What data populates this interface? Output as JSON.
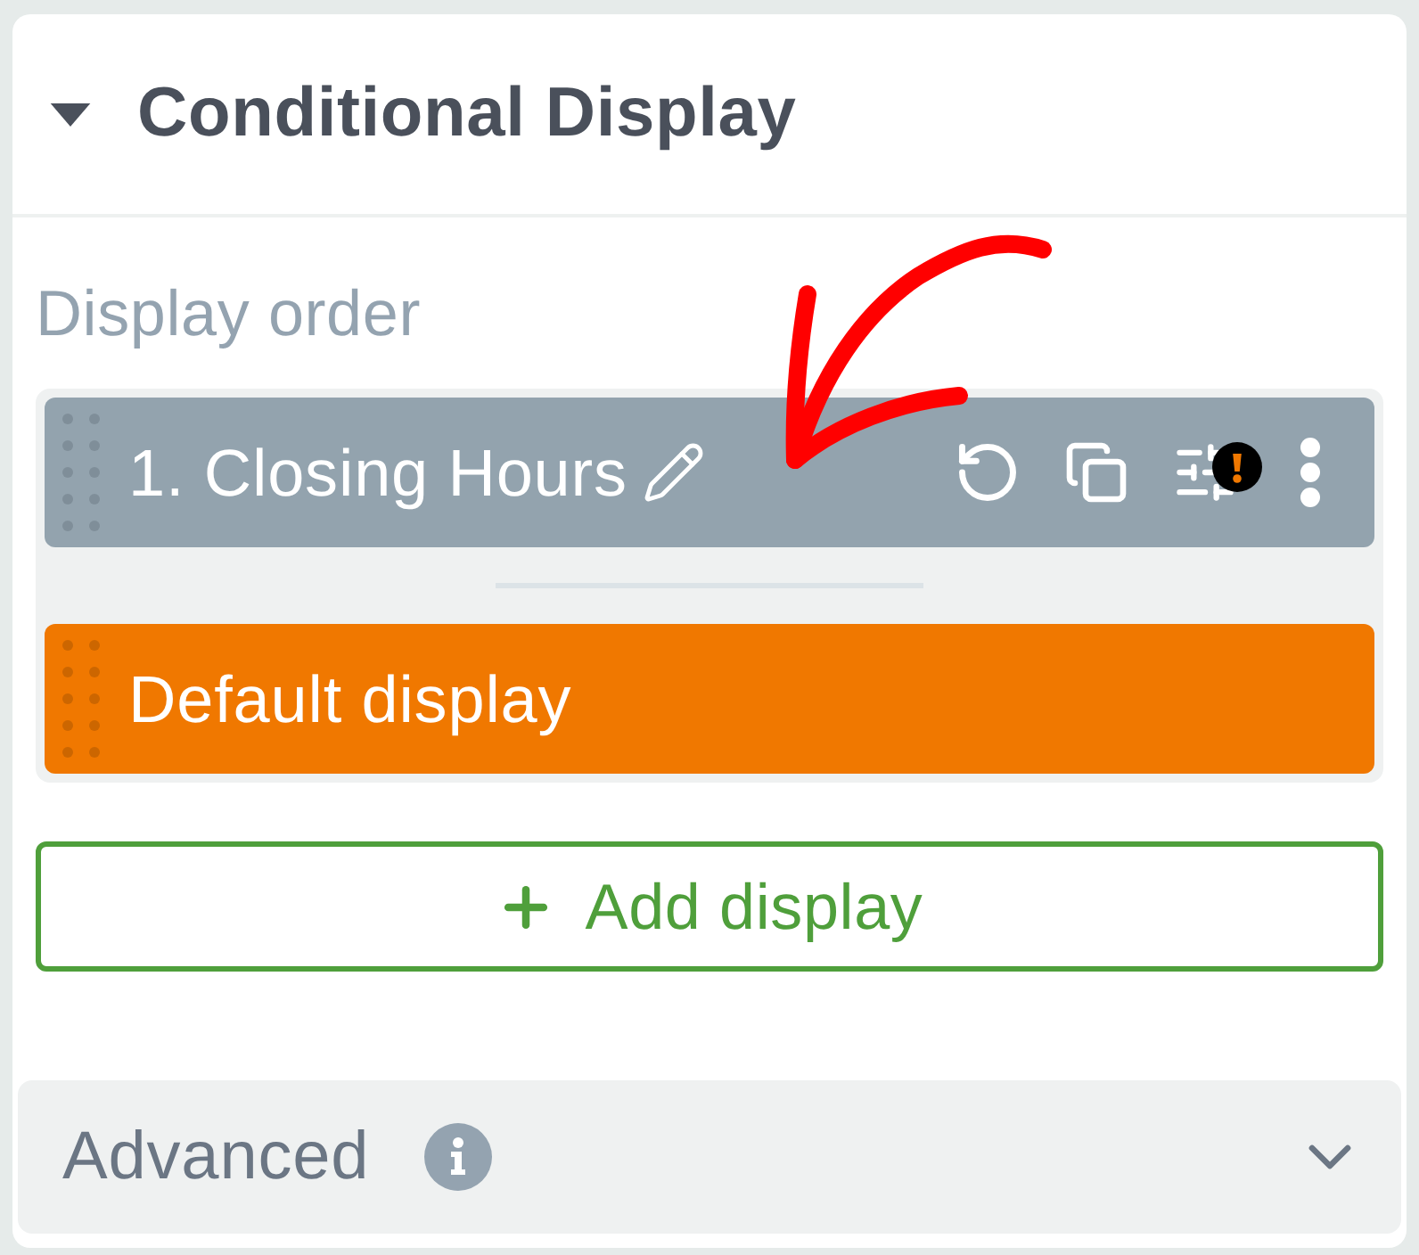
{
  "panel": {
    "title": "Conditional Display",
    "expanded": true
  },
  "display_order": {
    "label": "Display order",
    "items": [
      {
        "kind": "conditional",
        "name": "1. Closing Hours",
        "has_warning": true
      },
      {
        "kind": "default",
        "name": "Default display"
      }
    ]
  },
  "add_button": {
    "label": "Add display"
  },
  "advanced": {
    "label": "Advanced",
    "expanded": false
  }
}
